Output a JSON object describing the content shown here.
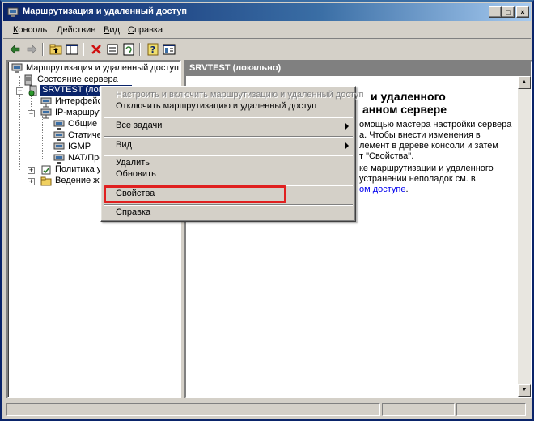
{
  "window": {
    "title": "Маршрутизация и удаленный доступ"
  },
  "titlebar_buttons": {
    "minimize": "_",
    "maximize": "□",
    "close": "×"
  },
  "menubar": [
    {
      "underline": "К",
      "rest": "онсоль"
    },
    {
      "underline": "Д",
      "rest": "ействие"
    },
    {
      "underline": "В",
      "rest": "ид"
    },
    {
      "underline": "С",
      "rest": "правка"
    }
  ],
  "toolbar_icons": [
    "back-arrow-icon",
    "forward-arrow-icon",
    "up-folder-icon",
    "show-tree-icon",
    "delete-icon",
    "properties-icon",
    "refresh-icon",
    "help-icon",
    "export-list-icon"
  ],
  "tree": {
    "root": "Маршрутизация и удаленный доступ",
    "server_status": "Состояние сервера",
    "server": "SRVTEST (локально)",
    "interfaces": "Интерфейсы с",
    "ip_routing": "IP-маршрутиз",
    "general": "Общие",
    "static": "Статически",
    "igmp": "IGMP",
    "nat": "NAT/Прост",
    "policy": "Политика уда",
    "logging": "Ведение журн"
  },
  "right_pane": {
    "header": "SRVTEST (локально)",
    "heading_line1": "и удаленного",
    "heading_line2": "анном сервере",
    "text": [
      "омощью мастера настройки сервера",
      "а. Чтобы внести изменения в",
      "лемент в дереве консоли и затем",
      "т \"Свойства\".",
      "ке маршрутизации и удаленного",
      " устранении неполадок см. в"
    ],
    "link": "ом доступе",
    "link_tail": "."
  },
  "context_menu": {
    "items": [
      {
        "label": "Настроить и включить маршрутизацию и удаленный доступ",
        "disabled": true
      },
      {
        "label": "Отключить маршрутизацию и удаленный доступ"
      },
      {
        "label": "Все задачи",
        "submenu": true
      },
      {
        "label": "Вид",
        "submenu": true
      },
      {
        "label": "Удалить"
      },
      {
        "label": "Обновить"
      },
      {
        "label": "Свойства",
        "highlighted": true
      },
      {
        "label": "Справка"
      }
    ]
  },
  "colors": {
    "highlight_box": "#e02020",
    "selection": "#0a246a",
    "titlebar_start": "#0a246a",
    "titlebar_end": "#a6caf0"
  }
}
